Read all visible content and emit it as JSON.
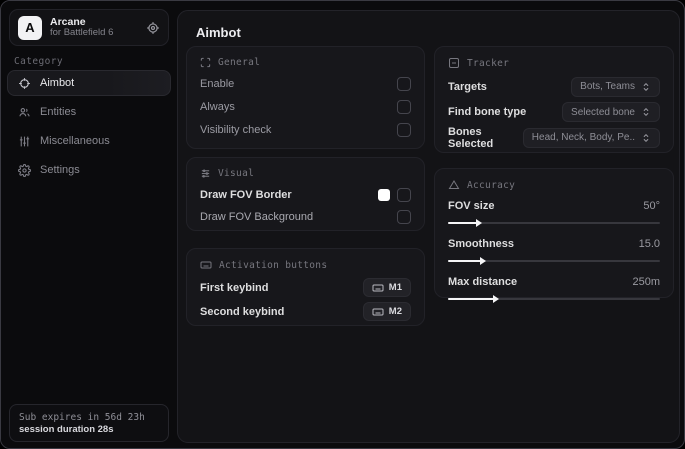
{
  "app": {
    "name": "Arcane",
    "subtitle": "for Battlefield 6",
    "logo_letter": "A"
  },
  "sidebar": {
    "category_label": "Category",
    "items": [
      {
        "label": "Aimbot",
        "icon": "crosshair-icon",
        "active": true
      },
      {
        "label": "Entities",
        "icon": "entities-icon",
        "active": false
      },
      {
        "label": "Miscellaneous",
        "icon": "sliders-vertical-icon",
        "active": false
      },
      {
        "label": "Settings",
        "icon": "gear-icon",
        "active": false
      }
    ],
    "footer": {
      "sub_expires": "Sub expires in 56d 23h",
      "session_duration": "session duration 28s"
    }
  },
  "main": {
    "title": "Aimbot",
    "panels": {
      "general": {
        "title": "General",
        "icon": "scan-icon",
        "rows": [
          {
            "label": "Enable",
            "control": "checkbox",
            "checked": false
          },
          {
            "label": "Always",
            "control": "checkbox",
            "checked": false
          },
          {
            "label": "Visibility check",
            "control": "checkbox",
            "checked": false
          }
        ]
      },
      "visual": {
        "title": "Visual",
        "icon": "tune-icon",
        "rows": [
          {
            "label": "Draw FOV Border",
            "control": "color+checkbox",
            "checked": false,
            "color": "#ffffff"
          },
          {
            "label": "Draw FOV Background",
            "control": "checkbox",
            "checked": false
          }
        ]
      },
      "activation": {
        "title": "Activation buttons",
        "icon": "keyboard-icon",
        "rows": [
          {
            "label": "First keybind",
            "key": "M1"
          },
          {
            "label": "Second keybind",
            "key": "M2"
          }
        ]
      },
      "tracker": {
        "title": "Tracker",
        "icon": "minus-square-icon",
        "rows": [
          {
            "label": "Targets",
            "value": "Bots, Teams"
          },
          {
            "label": "Find bone type",
            "value": "Selected bone"
          },
          {
            "label": "Bones Selected",
            "value": "Head, Neck, Body, Pe.."
          }
        ]
      },
      "accuracy": {
        "title": "Accuracy",
        "icon": "triangle-icon",
        "rows": [
          {
            "label": "FOV size",
            "value": "50°",
            "percent": 14
          },
          {
            "label": "Smoothness",
            "value": "15.0",
            "percent": 16
          },
          {
            "label": "Max distance",
            "value": "250m",
            "percent": 22
          }
        ]
      }
    }
  },
  "colors": {
    "window_bg": "#0b0b0d",
    "main_bg": "#131316",
    "panel_bg": "#17171b",
    "accent_white": "#f5f5f7",
    "text_primary": "#ececef",
    "text_muted": "#8e8e96"
  }
}
